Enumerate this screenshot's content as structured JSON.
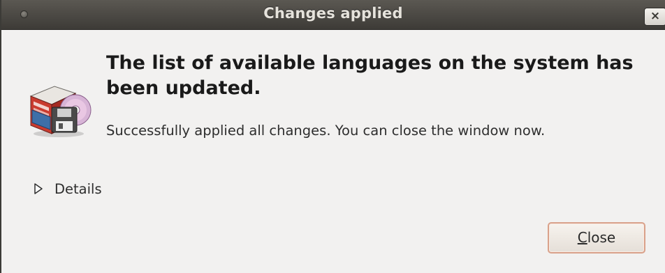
{
  "window": {
    "title": "Changes applied",
    "close_glyph": "×"
  },
  "dialog": {
    "icon": "language-support-icon",
    "heading": "The list of available languages on the system has been updated.",
    "message": "Successfully applied all changes. You can close the window now.",
    "details_label": "Details",
    "close_button": {
      "mnemonic": "C",
      "rest": "lose"
    }
  },
  "colors": {
    "titlebar": "#3d3b37",
    "title_text": "#e6e3dc",
    "dialog_bg": "#f2f1f0",
    "button_focus_border": "#d9a18a"
  }
}
